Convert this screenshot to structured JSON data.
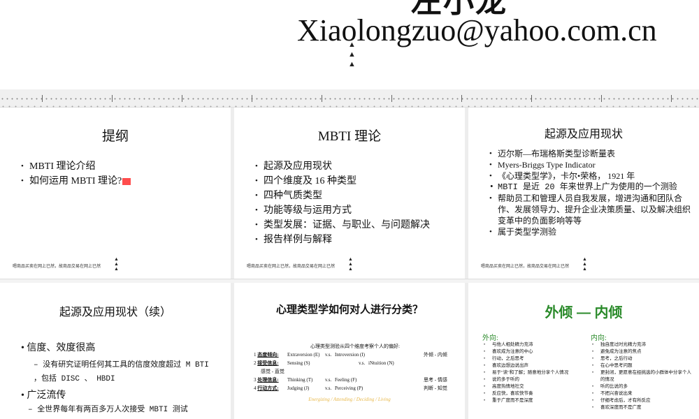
{
  "top": {
    "title_fragment": "左小龙",
    "email": "Xiaolongzuo@yahoo.com.cn"
  },
  "slides": {
    "outline": {
      "title": "提纲",
      "bullets": [
        "MBTI 理论介绍",
        "如何运用 MBTI 理论?"
      ]
    },
    "mbti_theory": {
      "title": "MBTI 理论",
      "bullets": [
        "起源及应用现状",
        "四个维度及 16 种类型",
        "四种气质类型",
        "功能等级与运用方式",
        "类型发展：证据、与职业、与问题解决",
        "报告样例与解释"
      ]
    },
    "origin": {
      "title": "起源及应用现状",
      "bullets": [
        "迈尔斯—布瑞格斯类型诊断量表",
        "Myers-Briggs Type Indicator",
        "《心理类型学》，卡尔•荣格， 1921 年",
        "MBTI 是近 20 年来世界上广为使用的一个测验",
        "帮助员工和管理人员自我发展，增进沟通和团队合作、发展领导力、提升企业决策质量、以及解决组织变革中的负面影响等等",
        "属于类型学测验"
      ]
    },
    "origin_cont": {
      "title": "起源及应用现状（续）",
      "b1": "信度、效度很高",
      "b1_sub": "没有研究证明任何其工具的信度效度超过 M BTI ，包括 DISC 、 HBDI",
      "b2": "广泛流传",
      "b2_sub": "全世界每年有两百多万人次接受 MBTI 测试"
    },
    "classify": {
      "title": "心理类型学如何对人进行分类？",
      "table_heading": "心理类型测验从四个维度考察个人的偏好:",
      "rows": [
        {
          "num": "1",
          "label": "态度倾向:",
          "a": "Extraversion (E)",
          "vs": "v.s.",
          "b": "Introversion (I)",
          "right": "外倾 - 内倾"
        },
        {
          "num": "2",
          "label": "接受信息:",
          "a": "Sensing (S)",
          "vs": "v.s.",
          "b": "iNtuition (N)",
          "right": "",
          "sub": "感觉 - 直觉"
        },
        {
          "num": "3",
          "label": "处理信息:",
          "a": "Thinking (T)",
          "vs": "v.s.",
          "b": "Feeling (F)",
          "right": "思考 - 情感"
        },
        {
          "num": "4",
          "label": "行动方式:",
          "a": "Judging (J)",
          "vs": "v.s.",
          "b": "Perceiving (P)",
          "right": "判断 - 知觉"
        }
      ],
      "motto": "Energizing / Attending / Deciding / Living"
    },
    "ei": {
      "title": "外倾 — 内倾",
      "left_head": "外向:",
      "left_items": [
        "与他人相处精力充沛",
        "喜欢成为注意的中心",
        "行动，之后思考",
        "喜欢边想边说出声",
        "易于\"读\"和了解；随意地分享个人情况",
        "说的多于听的",
        "高度热情地社交",
        "反应快，喜欢快节奏",
        "重于广度而不是深度"
      ],
      "right_head": "内向:",
      "right_items": [
        "独自度过时光精力充沛",
        "避免成为注意的焦点",
        "思考，之后行动",
        "在心中思考问题",
        "更封闭，更愿意在经挑选的小群体中分享个人的情况",
        "听的比说的多",
        "不把兴奋说出来",
        "仔细考虑后，才有所反应",
        "喜欢深度而不是广度"
      ]
    }
  },
  "footer_text": "嗯商品买卖在网上已然，故商品交易在网上已然"
}
